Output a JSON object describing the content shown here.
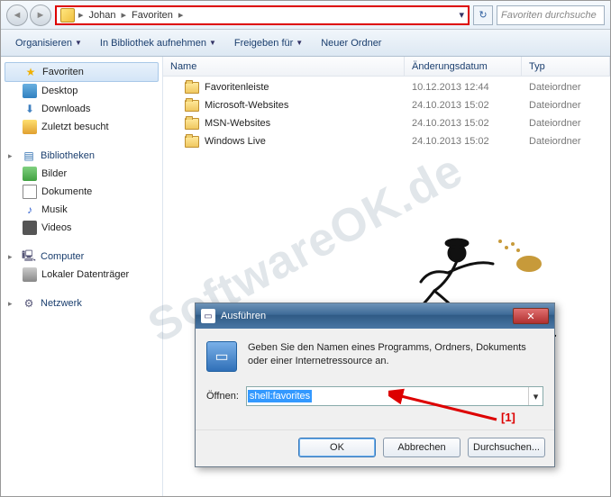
{
  "breadcrumb": {
    "seg1": "Johan",
    "seg2": "Favoriten"
  },
  "search": {
    "placeholder": "Favoriten durchsuche"
  },
  "toolbar": {
    "organize": "Organisieren",
    "include": "In Bibliothek aufnehmen",
    "share": "Freigeben für",
    "newfolder": "Neuer Ordner"
  },
  "sidebar": {
    "fav_head": "Favoriten",
    "desktop": "Desktop",
    "downloads": "Downloads",
    "recent": "Zuletzt besucht",
    "lib_head": "Bibliotheken",
    "pictures": "Bilder",
    "documents": "Dokumente",
    "music": "Musik",
    "videos": "Videos",
    "computer": "Computer",
    "localdisk": "Lokaler Datenträger",
    "network": "Netzwerk"
  },
  "columns": {
    "name": "Name",
    "date": "Änderungsdatum",
    "type": "Typ"
  },
  "rows": [
    {
      "name": "Favoritenleiste",
      "date": "10.12.2013 12:44",
      "type": "Dateiordner"
    },
    {
      "name": "Microsoft-Websites",
      "date": "24.10.2013 15:02",
      "type": "Dateiordner"
    },
    {
      "name": "MSN-Websites",
      "date": "24.10.2013 15:02",
      "type": "Dateiordner"
    },
    {
      "name": "Windows Live",
      "date": "24.10.2013 15:02",
      "type": "Dateiordner"
    }
  ],
  "dialog": {
    "title": "Ausführen",
    "desc": "Geben Sie den Namen eines Programms, Ordners, Dokuments oder einer Internetressource an.",
    "open_label": "Öffnen:",
    "value": "shell:favorites",
    "ok": "OK",
    "cancel": "Abbrechen",
    "browse": "Durchsuchen..."
  },
  "annotation": {
    "label": "[1]"
  },
  "watermark": "SoftwareOK.de"
}
